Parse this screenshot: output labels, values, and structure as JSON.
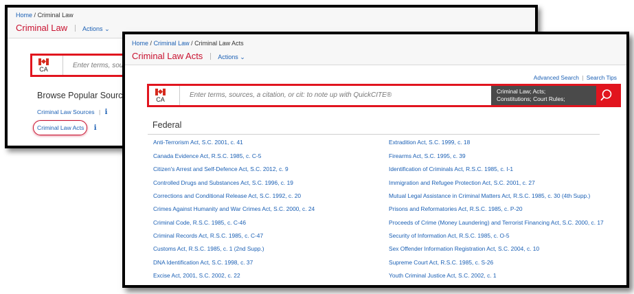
{
  "back": {
    "breadcrumb": {
      "home": "Home",
      "sep": "/",
      "current": "Criminal Law"
    },
    "title": "Criminal Law",
    "actions": "Actions",
    "search": {
      "country": "CA",
      "placeholder": "Enter terms, sou"
    },
    "browse_heading": "Browse Popular Source",
    "sources_link": "Criminal Law Sources",
    "sources_sep": "|",
    "info": "i",
    "acts_link": "Criminal Law Acts"
  },
  "front": {
    "breadcrumb": {
      "home": "Home",
      "sep1": "/",
      "mid": "Criminal Law",
      "sep2": "/",
      "current": "Criminal Law Acts"
    },
    "title": "Criminal Law Acts",
    "actions": "Actions",
    "advanced_search": "Advanced Search",
    "search_tips": "Search Tips",
    "search": {
      "country": "CA",
      "placeholder": "Enter terms, sources, a citation, or cit: to note up with QuickCITE®",
      "filter_line1": "Criminal Law; Acts;",
      "filter_line2": "Constitutions; Court Rules;"
    },
    "section_heading": "Federal",
    "acts_left": [
      "Anti-Terrorism Act, S.C. 2001, c. 41",
      "Canada Evidence Act, R.S.C. 1985, c. C-5",
      "Citizen's Arrest and Self-Defence Act, S.C. 2012, c. 9",
      "Controlled Drugs and Substances Act, S.C. 1996, c. 19",
      "Corrections and Conditional Release Act, S.C. 1992, c. 20",
      "Crimes Against Humanity and War Crimes Act, S.C. 2000, c. 24",
      "Criminal Code, R.S.C. 1985, c. C-46",
      "Criminal Records Act, R.S.C. 1985, c. C-47",
      "Customs Act, R.S.C. 1985, c. 1 (2nd Supp.)",
      "DNA Identification Act, S.C. 1998, c. 37",
      "Excise Act, 2001, S.C. 2002, c. 22"
    ],
    "acts_right": [
      "Extradition Act, S.C. 1999, c. 18",
      "Firearms Act, S.C. 1995, c. 39",
      "Identification of Criminals Act, R.S.C. 1985, c. I-1",
      "Immigration and Refugee Protection Act, S.C. 2001, c. 27",
      "Mutual Legal Assistance in Criminal Matters Act, R.S.C. 1985, c. 30 (4th Supp.)",
      "Prisons and Reformatories Act, R.S.C. 1985, c. P-20",
      "Proceeds of Crime (Money Laundering) and Terrorist Financing Act, S.C. 2000, c. 17",
      "Security of Information Act, R.S.C. 1985, c. O-5",
      "Sex Offender Information Registration Act, S.C. 2004, c. 10",
      "Supreme Court Act, R.S.C. 1985, c. S-26",
      "Youth Criminal Justice Act, S.C. 2002, c. 1"
    ]
  }
}
